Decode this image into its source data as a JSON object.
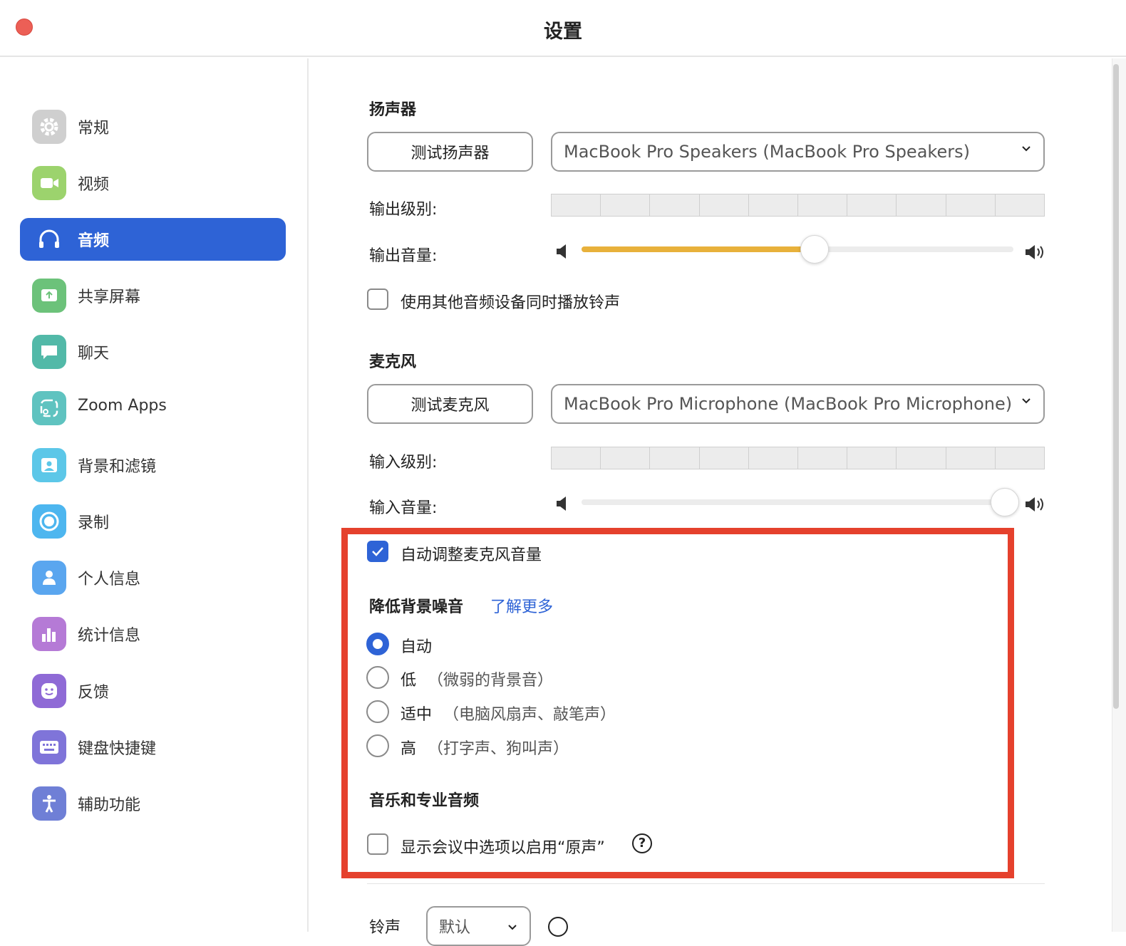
{
  "window": {
    "title": "设置"
  },
  "sidebar": {
    "items": [
      {
        "label": "常规",
        "icon": "gear-icon",
        "color": "#cfcfcf"
      },
      {
        "label": "视频",
        "icon": "video-camera-icon",
        "color": "#9cd36d"
      },
      {
        "label": "音频",
        "icon": "headphones-icon",
        "color": "#2e63d6",
        "active": true
      },
      {
        "label": "共享屏幕",
        "icon": "share-screen-icon",
        "color": "#6cc27a"
      },
      {
        "label": "聊天",
        "icon": "chat-bubble-icon",
        "color": "#52b9a8"
      },
      {
        "label": "Zoom Apps",
        "icon": "zoom-apps-icon",
        "color": "#5fc3c0"
      },
      {
        "label": "背景和滤镜",
        "icon": "background-icon",
        "color": "#5cc7e8"
      },
      {
        "label": "录制",
        "icon": "record-icon",
        "color": "#4db6ef"
      },
      {
        "label": "个人信息",
        "icon": "profile-icon",
        "color": "#5aa6ef"
      },
      {
        "label": "统计信息",
        "icon": "statistics-icon",
        "color": "#b57ad6"
      },
      {
        "label": "反馈",
        "icon": "feedback-smile-icon",
        "color": "#8f6ad6"
      },
      {
        "label": "键盘快捷键",
        "icon": "keyboard-icon",
        "color": "#7f74d9"
      },
      {
        "label": "辅助功能",
        "icon": "accessibility-icon",
        "color": "#6f7fd6"
      }
    ]
  },
  "speaker": {
    "section_title": "扬声器",
    "test_button": "测试扬声器",
    "device": "MacBook Pro Speakers (MacBook Pro Speakers)",
    "output_level_label": "输出级别:",
    "output_volume_label": "输出音量:",
    "output_volume_fraction": 0.54,
    "ringtone_checkbox": {
      "label": "使用其他音频设备同时播放铃声",
      "checked": false
    }
  },
  "microphone": {
    "section_title": "麦克风",
    "test_button": "测试麦克风",
    "device": "MacBook Pro Microphone (MacBook Pro Microphone)",
    "input_level_label": "输入级别:",
    "input_volume_label": "输入音量:",
    "input_volume_fraction": 0.98,
    "auto_adjust": {
      "label": "自动调整麦克风音量",
      "checked": true
    }
  },
  "noise_suppression": {
    "title": "降低背景噪音",
    "learn_more": "了解更多",
    "options": [
      {
        "label": "自动",
        "hint": "",
        "selected": true
      },
      {
        "label": "低",
        "hint": "（微弱的背景音）",
        "selected": false
      },
      {
        "label": "适中",
        "hint": "（电脑风扇声、敲笔声）",
        "selected": false
      },
      {
        "label": "高",
        "hint": "（打字声、狗叫声）",
        "selected": false
      }
    ]
  },
  "music_audio": {
    "title": "音乐和专业音频",
    "original_sound": {
      "label": "显示会议中选项以启用“原声”",
      "checked": false
    },
    "help": "?"
  },
  "ringtone": {
    "label": "铃声",
    "value": "默认"
  },
  "colors": {
    "accent": "#2e63d6",
    "slider_fill": "#e8b13b",
    "highlight": "#e5412d"
  }
}
